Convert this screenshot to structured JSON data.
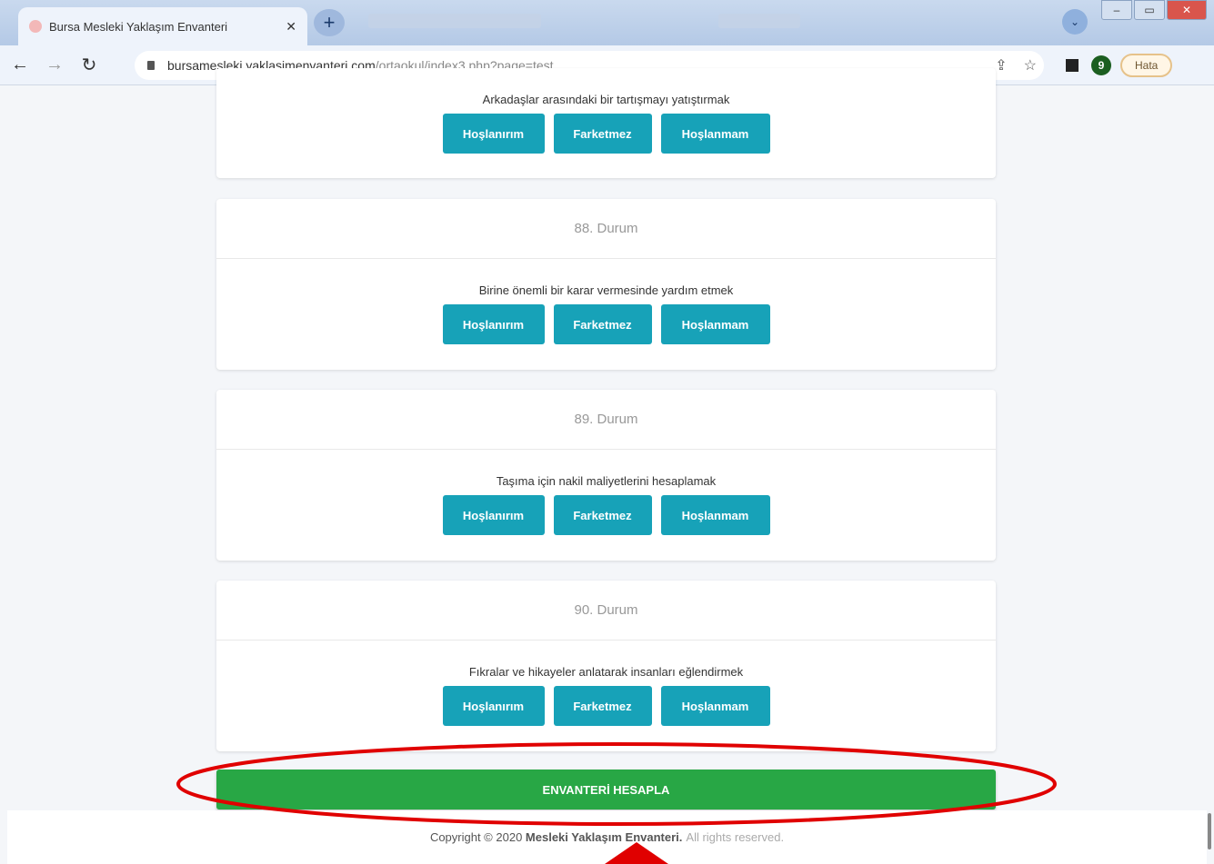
{
  "browser": {
    "tab_title": "Bursa Mesleki Yaklaşım Envanteri",
    "tab_close": "✕",
    "new_tab": "+",
    "url_domain": "bursamesleki yaklasimenvanteri.com",
    "url_path": "/ortaokul/index3.php?page=test",
    "error_badge": "Hata",
    "avatar_letter": "9"
  },
  "items": [
    {
      "number": "",
      "question": "Arkadaşlar arasındaki bir tartışmayı yatıştırmak"
    },
    {
      "number": "88. Durum",
      "question": "Birine önemli bir karar vermesinde yardım etmek"
    },
    {
      "number": "89. Durum",
      "question": "Taşıma için nakil maliyetlerini hesaplamak"
    },
    {
      "number": "90. Durum",
      "question": "Fıkralar ve hikayeler anlatarak insanları eğlendirmek"
    }
  ],
  "choices": {
    "like": "Hoşlanırım",
    "neutral": "Farketmez",
    "dislike": "Hoşlanmam"
  },
  "submit_label": "ENVANTERİ HESAPLA",
  "footer": {
    "prefix": "Copyright © 2020",
    "brand": "Mesleki Yaklaşım Envanteri.",
    "rights": "All rights reserved."
  },
  "annotation_color": "#e00000"
}
